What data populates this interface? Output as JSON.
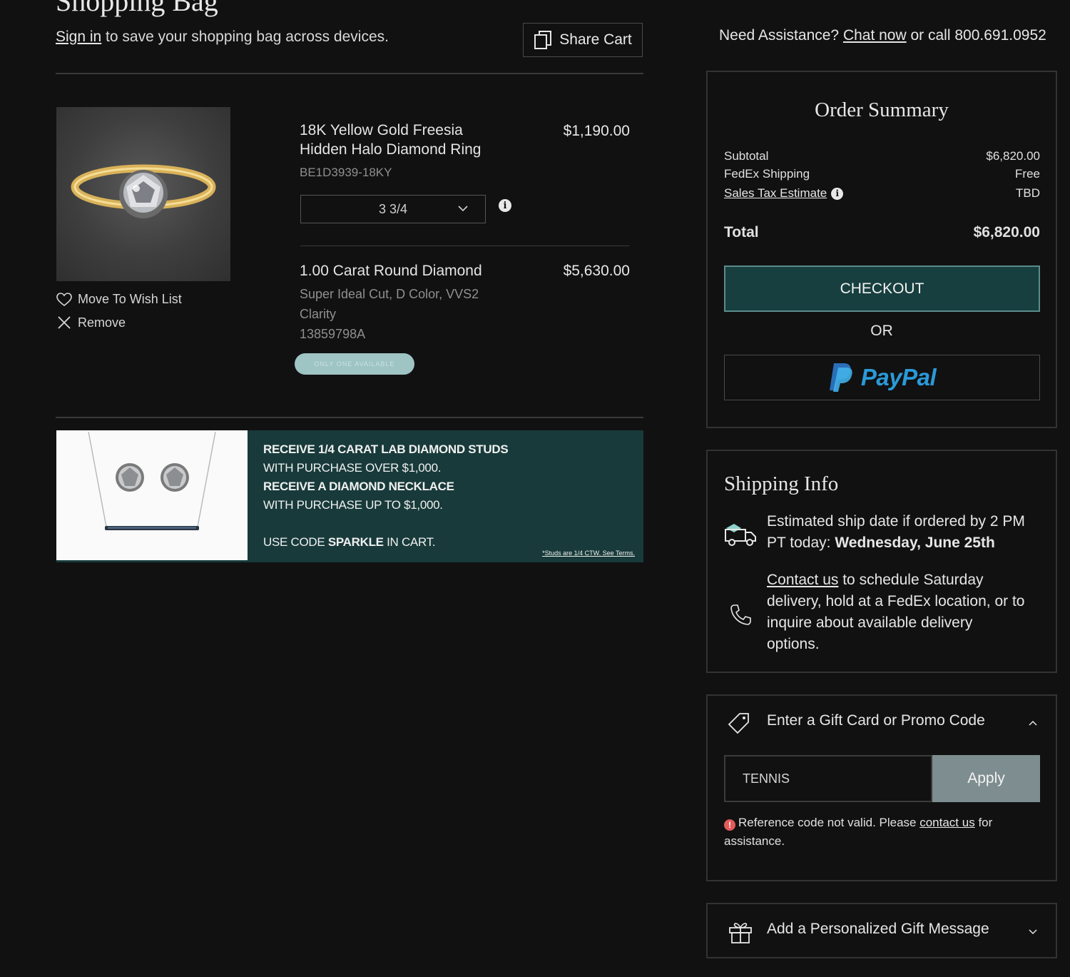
{
  "header": {
    "title": "Shopping Bag",
    "signin_link": "Sign in",
    "signin_rest": " to save your shopping bag across devices.",
    "share_label": "Share Cart"
  },
  "item": {
    "name_line1": "18K Yellow Gold Freesia",
    "name_line2": "Hidden Halo Diamond Ring",
    "sku": "BE1D3939-18KY",
    "price": "$1,190.00",
    "size_value": "3 3/4",
    "info_glyph": "i",
    "wishlist_label": "Move To Wish List",
    "remove_label": "Remove"
  },
  "diamond": {
    "name": "1.00 Carat Round Diamond",
    "desc_line1": "Super Ideal Cut, D Color, VVS2",
    "desc_line2": "Clarity",
    "sku": "13859798A",
    "price": "$5,630.00",
    "badge": "ONLY ONE AVAILABLE"
  },
  "promo": {
    "line1": "RECEIVE 1/4 CARAT LAB DIAMOND STUDS",
    "line2": "WITH PURCHASE OVER $1,000.",
    "line3": "RECEIVE A DIAMOND NECKLACE",
    "line4": "WITH PURCHASE UP TO $1,000.",
    "code_prefix": "USE CODE ",
    "code": "SPARKLE",
    "code_suffix": " IN CART.",
    "terms": "*Studs are 1/4 CTW. See Terms."
  },
  "assist": {
    "prefix": "Need Assistance? ",
    "chat_link": "Chat now",
    "suffix": " or call 800.691.0952"
  },
  "summary": {
    "title": "Order Summary",
    "subtotal_label": "Subtotal",
    "subtotal_value": "$6,820.00",
    "shipping_label": "FedEx Shipping",
    "shipping_value": "Free",
    "tax_label": "Sales Tax Estimate",
    "tax_value": "TBD",
    "total_label": "Total",
    "total_value": "$6,820.00",
    "checkout_label": "CHECKOUT",
    "or_label": "OR",
    "paypal_label": "PayPal"
  },
  "shipping": {
    "title": "Shipping Info",
    "estimate_line1": "Estimated ship date if ordered by 2 PM",
    "estimate_prefix": "PT today: ",
    "estimate_date": "Wednesday, June 25th",
    "contact_link": "Contact us",
    "contact_line1_rest": " to schedule Saturday",
    "contact_line2": "delivery, hold at a FedEx location, or to",
    "contact_line3": "inquire about available delivery",
    "contact_line4": "options."
  },
  "promo_code": {
    "heading": "Enter a Gift Card or Promo Code",
    "input_value": "TENNIS",
    "apply_label": "Apply",
    "error_glyph": "!",
    "error_prefix": "Reference code not valid. Please ",
    "error_link": "contact us",
    "error_suffix": " for assistance."
  },
  "gift_message": {
    "heading": "Add a Personalized Gift Message"
  },
  "colors": {
    "background": "#111112",
    "accent_teal": "#183f3f",
    "paypal_blue": "#2a9ad8",
    "error_red": "#e35a5a"
  },
  "icons": [
    "share-icon",
    "heart-icon",
    "close-icon",
    "chevron-down-icon",
    "info-icon",
    "truck-icon",
    "phone-icon",
    "tag-icon",
    "chevron-up-icon",
    "gift-icon",
    "error-icon",
    "paypal-logo-icon"
  ]
}
